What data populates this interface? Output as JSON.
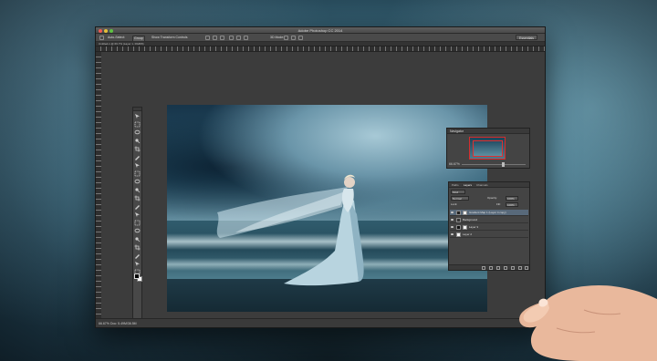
{
  "window": {
    "title": "Adobe Photoshop CC 2014",
    "workspace": "Essentials"
  },
  "options_bar": {
    "auto_select": "Auto-Select:",
    "auto_select_value": "Group",
    "show_transform": "Show Transform Controls",
    "mode_3d": "3D Mode:"
  },
  "document": {
    "tab_label": "Untitled-1 @ 66.7% (Layer 1, RGB/8)"
  },
  "navigator": {
    "title": "Navigator",
    "zoom": "66.67%"
  },
  "layers": {
    "tabs": [
      "Paths",
      "Layers",
      "Channels"
    ],
    "active_tab": "Layers",
    "kind_filter": "Kind",
    "blend_mode": "Normal",
    "opacity_label": "Opacity:",
    "opacity_value": "100%",
    "lock_label": "Lock:",
    "fill_label": "Fill:",
    "fill_value": "100%",
    "items": [
      {
        "name": "Gradient Map 1 (Layer 4 copy)",
        "selected": true
      },
      {
        "name": "Background",
        "selected": false
      },
      {
        "name": "Layer 3",
        "selected": false
      },
      {
        "name": "Layer 2",
        "selected": false
      }
    ]
  },
  "status": {
    "zoom": "66.67%",
    "doc": "Doc: 5.49M/36.5M"
  },
  "colors": {
    "panel_bg": "#444444",
    "selected_layer": "#58697a",
    "navigator_frame": "#d62c2c"
  },
  "tools": [
    "move-tool",
    "marquee-tool",
    "lasso-tool",
    "quick-select-tool",
    "crop-tool",
    "eyedropper-tool",
    "healing-brush-tool",
    "brush-tool",
    "clone-stamp-tool",
    "history-brush-tool",
    "eraser-tool",
    "gradient-tool",
    "blur-tool",
    "dodge-tool",
    "pen-tool",
    "type-tool",
    "path-select-tool",
    "shape-tool",
    "hand-tool",
    "zoom-tool"
  ]
}
